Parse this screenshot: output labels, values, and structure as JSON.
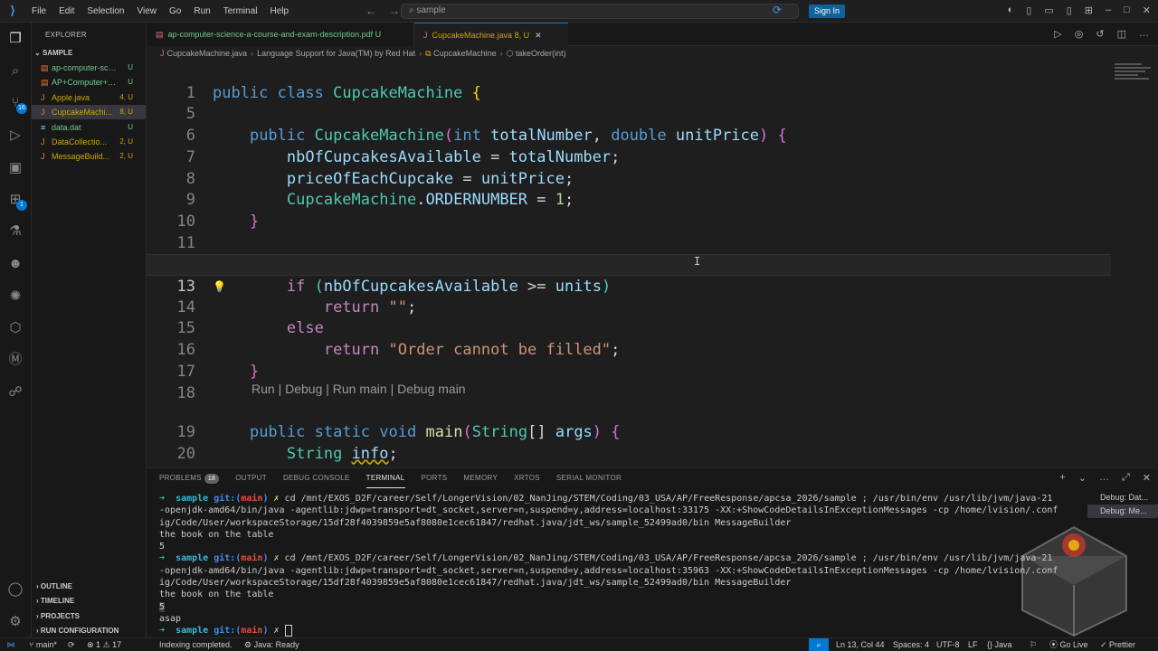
{
  "menu": [
    "File",
    "Edit",
    "Selection",
    "View",
    "Go",
    "Run",
    "Terminal",
    "Help"
  ],
  "search": {
    "value": "sample"
  },
  "signin": "Sign In",
  "sidebar": {
    "title": "EXPLORER",
    "folder": "SAMPLE",
    "files": [
      {
        "name": "ap-computer-sci...",
        "status": "U",
        "icon": "pdf",
        "warn": false
      },
      {
        "name": "AP+Computer+S...",
        "status": "U",
        "icon": "pdf",
        "warn": false
      },
      {
        "name": "Apple.java",
        "status": "4, U",
        "icon": "java",
        "warn": true
      },
      {
        "name": "CupcakeMachi...",
        "status": "8, U",
        "icon": "java",
        "warn": true
      },
      {
        "name": "data.dat",
        "status": "U",
        "icon": "dat",
        "warn": false
      },
      {
        "name": "DataCollectio...",
        "status": "2, U",
        "icon": "java",
        "warn": true
      },
      {
        "name": "MessageBuild...",
        "status": "2, U",
        "icon": "java",
        "warn": true
      }
    ],
    "bottom": [
      "OUTLINE",
      "TIMELINE",
      "PROJECTS",
      "RUN CONFIGURATION"
    ]
  },
  "activity_badges": {
    "scm": "16",
    "extensions": "1"
  },
  "tabs": [
    {
      "label": "ap-computer-science-a-course-and-exam-description.pdf",
      "status": "U"
    },
    {
      "label": "CupcakeMachine.java",
      "status": "8, U"
    }
  ],
  "breadcrumb": [
    "CupcakeMachine.java",
    "Language Support for Java(TM) by Red Hat",
    "CupcakeMachine",
    "takeOrder(int)"
  ],
  "editor": {
    "line_numbers": [
      "1",
      "5",
      "6",
      "7",
      "8",
      "9",
      "10",
      "11",
      "12",
      "13",
      "14",
      "15",
      "16",
      "17",
      "18",
      "19",
      "20",
      "21"
    ],
    "codelens": "Run | Debug | Run main | Debug main"
  },
  "panel": {
    "tabs": [
      "PROBLEMS",
      "OUTPUT",
      "DEBUG CONSOLE",
      "TERMINAL",
      "PORTS",
      "MEMORY",
      "XRTOS",
      "SERIAL MONITOR"
    ],
    "problems_count": "18",
    "active_tab": "TERMINAL",
    "debug_sessions": [
      "Debug: Dat...",
      "Debug: Me..."
    ],
    "terminal": {
      "dir": "sample",
      "git": "git:(",
      "branch": "main",
      "cmd1_a": " cd /mnt/EXOS_D2F/career/Self/LongerVision/02_NanJing/STEM/Coding/03_USA/AP/FreeResponse/apcsa_2026/sample ; /usr/bin/env /usr/lib/jvm/java-21",
      "cmd1_b": "-openjdk-amd64/bin/java -agentlib:jdwp=transport=dt_socket,server=n,suspend=y,address=localhost:33175 -XX:+ShowCodeDetailsInExceptionMessages -cp /home/lvision/.conf",
      "cmd1_c": "ig/Code/User/workspaceStorage/15df28f4039859e5af8080e1cec61847/redhat.java/jdt_ws/sample_52499ad0/bin MessageBuilder",
      "out1_a": "the book on the table",
      "out1_b": "5",
      "cmd2_a": " cd /mnt/EXOS_D2F/career/Self/LongerVision/02_NanJing/STEM/Coding/03_USA/AP/FreeResponse/apcsa_2026/sample ; /usr/bin/env /usr/lib/jvm/java-21",
      "cmd2_b": "-openjdk-amd64/bin/java -agentlib:jdwp=transport=dt_socket,server=n,suspend=y,address=localhost:35963 -XX:+ShowCodeDetailsInExceptionMessages -cp /home/lvision/.conf",
      "cmd2_c": "ig/Code/User/workspaceStorage/15df28f4039859e5af8080e1cec61847/redhat.java/jdt_ws/sample_52499ad0/bin MessageBuilder",
      "out2_a": "the book on the table",
      "out2_b": "5",
      "out2_c": "asap"
    }
  },
  "status": {
    "branch": "main*",
    "errors": "1",
    "warnings": "17",
    "indexing": "Indexing completed.",
    "java_ready": "Java: Ready",
    "position": "Ln 13, Col 44",
    "spaces": "Spaces: 4",
    "encoding": "UTF-8",
    "eol": "LF",
    "language": "Java",
    "golive": "Go Live",
    "prettier": "Prettier"
  },
  "colors": {
    "accent": "#0078d4",
    "keyword": "#569cd6",
    "type": "#4ec9b0",
    "string": "#ce9178",
    "added": "#73c991",
    "modified": "#cca700"
  }
}
